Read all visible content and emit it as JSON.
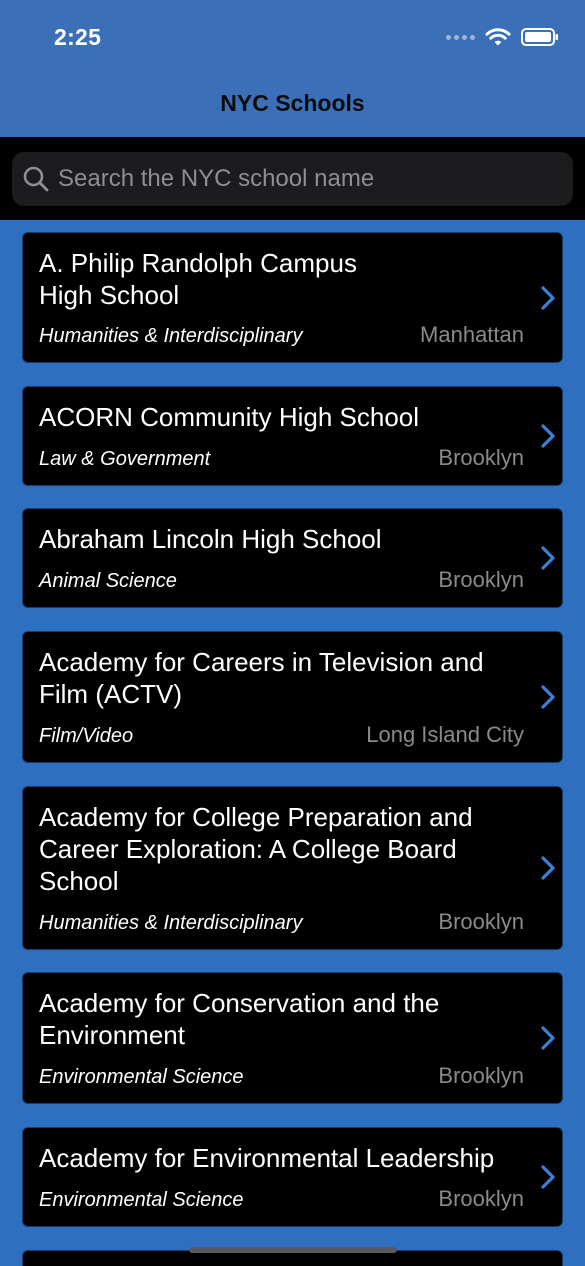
{
  "status_bar": {
    "time": "2:25"
  },
  "nav": {
    "title": "NYC Schools"
  },
  "search": {
    "placeholder": "Search the NYC school name",
    "value": ""
  },
  "schools": [
    {
      "name": "A. Philip Randolph Campus\nHigh School",
      "category": "Humanities & Interdisciplinary",
      "borough": "Manhattan"
    },
    {
      "name": "ACORN Community High School",
      "category": "Law & Government",
      "borough": "Brooklyn"
    },
    {
      "name": "Abraham Lincoln High School",
      "category": "Animal Science",
      "borough": "Brooklyn"
    },
    {
      "name": "Academy for Careers in Television and Film (ACTV)",
      "category": "Film/Video",
      "borough": "Long Island City"
    },
    {
      "name": "Academy for College Preparation and Career Exploration: A College Board School",
      "category": "Humanities & Interdisciplinary",
      "borough": "Brooklyn"
    },
    {
      "name": "Academy for Conservation and the Environment",
      "category": "Environmental Science",
      "borough": "Brooklyn"
    },
    {
      "name": "Academy for Environmental Leadership",
      "category": "Environmental Science",
      "borough": "Brooklyn"
    },
    {
      "name": "",
      "category": "",
      "borough": ""
    }
  ],
  "colors": {
    "accent": "#3a82d6",
    "header": "#3b70b8",
    "background": "#2f6fbf"
  },
  "icons": {
    "search": "search-icon",
    "chevron": "chevron-right-icon",
    "wifi": "wifi-icon",
    "battery": "battery-icon"
  }
}
